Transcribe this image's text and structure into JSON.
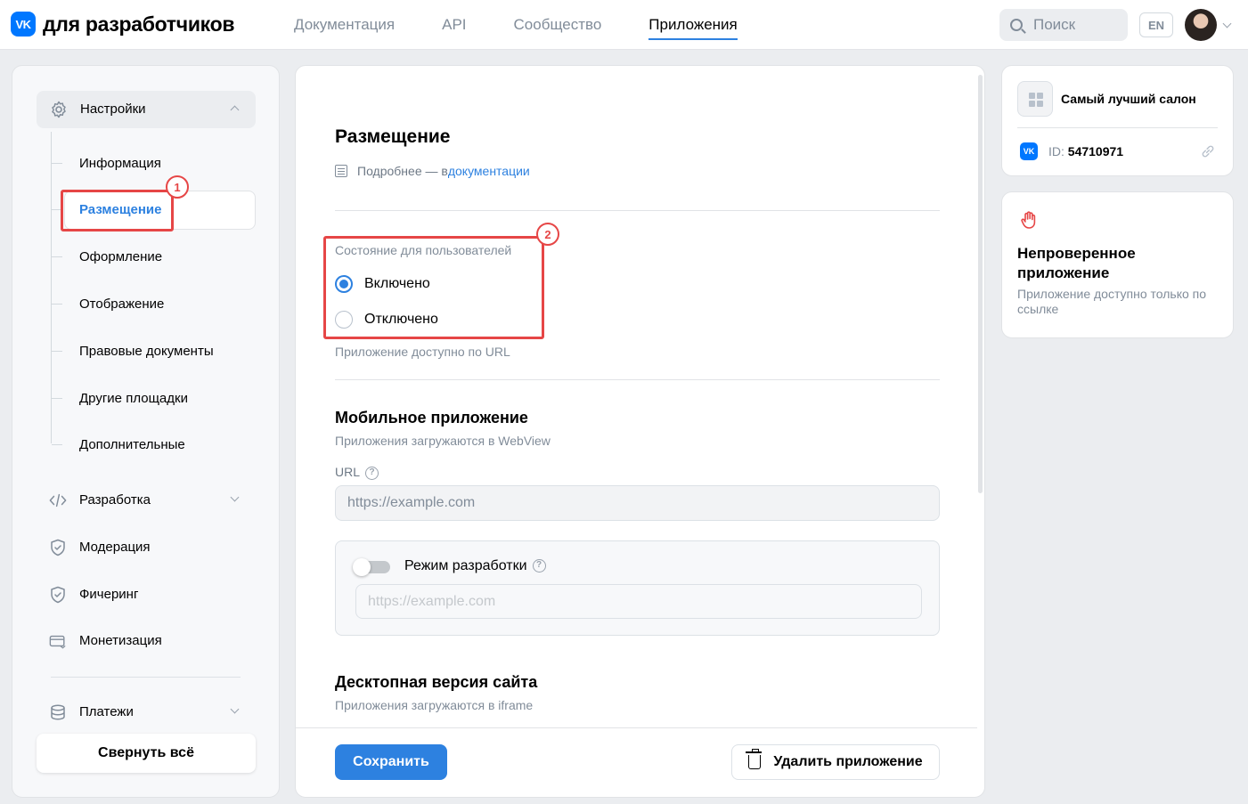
{
  "header": {
    "logo_mark": "VK",
    "logo_text": "для разработчиков",
    "nav": [
      "Документация",
      "API",
      "Сообщество",
      "Приложения"
    ],
    "active_nav": "Приложения",
    "search_placeholder": "Поиск",
    "lang": "EN"
  },
  "sidebar": {
    "settings_label": "Настройки",
    "settings_items": [
      "Информация",
      "Размещение",
      "Оформление",
      "Отображение",
      "Правовые документы",
      "Другие площадки",
      "Дополнительные"
    ],
    "active_item": "Размещение",
    "sections": [
      "Разработка",
      "Модерация",
      "Фичеринг",
      "Монетизация",
      "Платежи"
    ],
    "collapse_label": "Свернуть всё"
  },
  "annotations": {
    "badge_1": "1",
    "badge_2": "2"
  },
  "main": {
    "title": "Размещение",
    "doc_prefix": "Подробнее — в ",
    "doc_link": "документации",
    "state_label": "Состояние для пользователей",
    "radio_on": "Включено",
    "radio_off": "Отключено",
    "selected": "Включено",
    "state_hint": "Приложение доступно по URL",
    "mobile_title": "Мобильное приложение",
    "mobile_hint": "Приложения загружаются в WebView",
    "url_label": "URL",
    "url_placeholder": "https://example.com",
    "dev_mode_label": "Режим разработки",
    "dev_url_placeholder": "https://example.com",
    "desktop_title": "Десктопная версия сайта",
    "desktop_hint": "Приложения загружаются в iframe",
    "save_label": "Сохранить",
    "delete_label": "Удалить приложение"
  },
  "app_card": {
    "name": "Самый лучший салон",
    "id_label": "ID:",
    "id_value": "54710971"
  },
  "status_card": {
    "title": "Непроверенное приложение",
    "description": "Приложение доступно только по ссылке"
  },
  "colors": {
    "accent": "#2d81e0",
    "annotation": "#e64646",
    "vk_blue": "#0077ff"
  }
}
